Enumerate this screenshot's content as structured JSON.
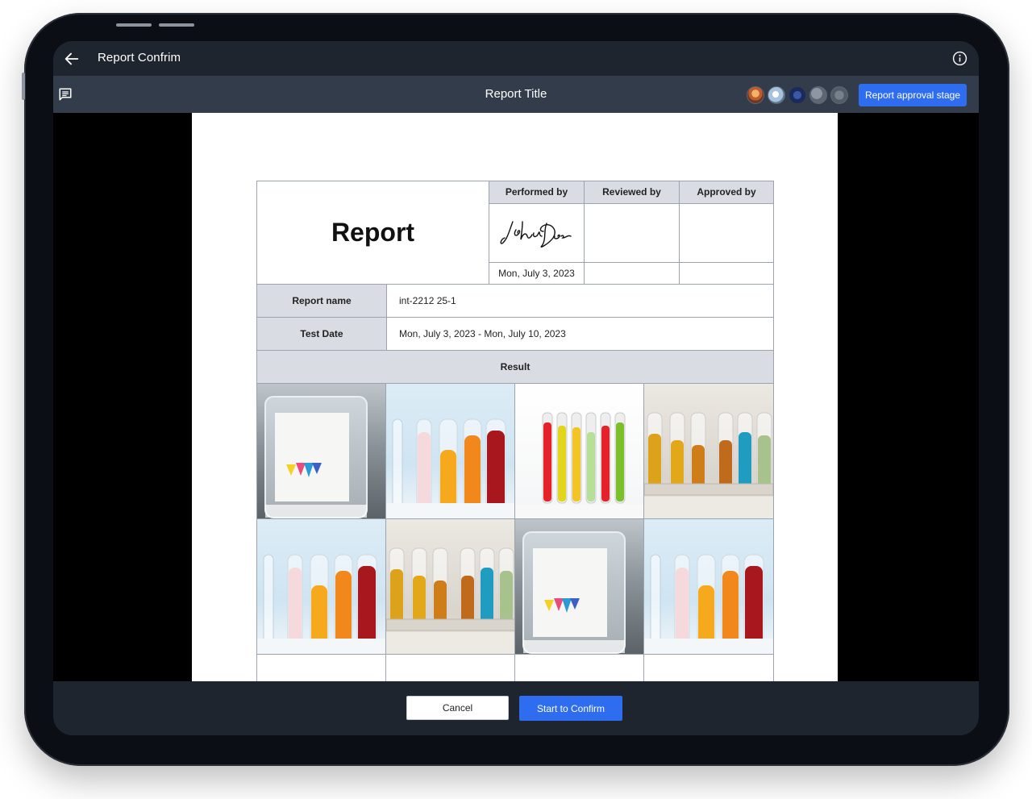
{
  "window": {
    "title": "Report Confrim"
  },
  "subbar": {
    "title": "Report Title",
    "approval_button": "Report approval stage",
    "avatars": [
      "avatar-1",
      "avatar-2",
      "avatar-3",
      "avatar-4",
      "avatar-5"
    ]
  },
  "document": {
    "heading": "Report",
    "signatures": [
      {
        "role": "Performed by",
        "signature": "John Doe",
        "date": "Mon, July 3, 2023"
      },
      {
        "role": "Reviewed by",
        "signature": "",
        "date": ""
      },
      {
        "role": "Approved by",
        "signature": "",
        "date": ""
      }
    ],
    "fields": [
      {
        "label": "Report name",
        "value": "int-2212 25-1"
      },
      {
        "label": "Test Date",
        "value": "Mon, July 3, 2023 - Mon, July 10, 2023"
      }
    ],
    "result_label": "Result",
    "photos": [
      "beaker-chromatography-photo",
      "test-tubes-colored-photo",
      "test-tubes-bright-photo",
      "test-tubes-rack-photo",
      "test-tubes-colored-photo",
      "test-tubes-rack-photo",
      "beaker-chromatography-photo",
      "test-tubes-colored-photo"
    ]
  },
  "footer": {
    "cancel_label": "Cancel",
    "confirm_label": "Start to Confirm"
  },
  "icons": {
    "back": "back-arrow-icon",
    "info": "info-icon",
    "comments": "comment-icon"
  },
  "colors": {
    "accent": "#2f6df0",
    "header_bg": "#1f252e",
    "subheader_bg": "#333c4a",
    "table_head": "#d9dde3"
  }
}
